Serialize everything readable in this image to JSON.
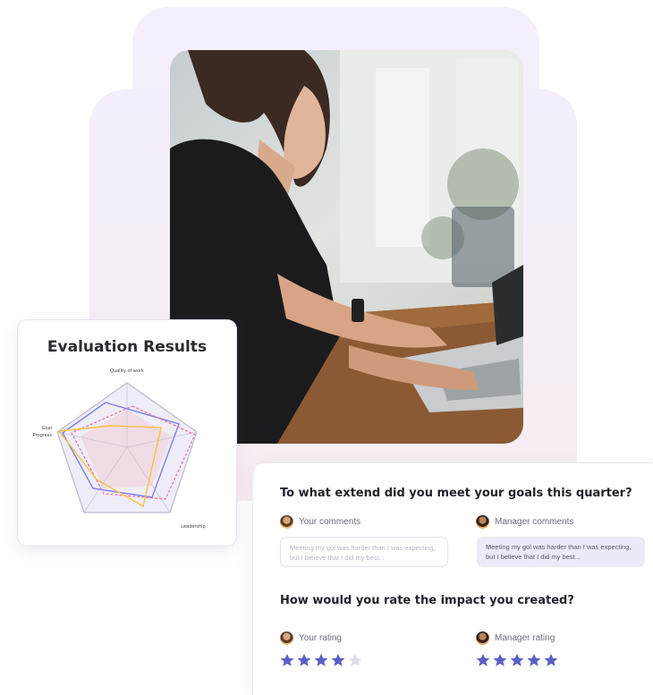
{
  "evaluation": {
    "title": "Evaluation Results",
    "axes": [
      "Quality of work",
      "Goal Progress",
      "Leadership"
    ],
    "series_colors": [
      "#7b7ff0",
      "#f06aa0",
      "#f7c23f"
    ]
  },
  "questions": [
    {
      "title": "To what extend did you meet your goals this quarter?",
      "your_label": "Your comments",
      "manager_label": "Manager comments",
      "your_comment": "Meeting my gol was harder than I was expecting, but I believe that I did my best...",
      "manager_comment": "Meeting my gol was harder than I was expecting, but I believe that I did my best..."
    },
    {
      "title": "How would you rate the impact you created?",
      "your_label": "Your rating",
      "manager_label": "Manager rating",
      "your_rating": 4,
      "manager_rating": 5,
      "rating_max": 5
    }
  ],
  "colors": {
    "star_filled": "#5b5fc7",
    "star_empty": "#dcdcf2"
  }
}
